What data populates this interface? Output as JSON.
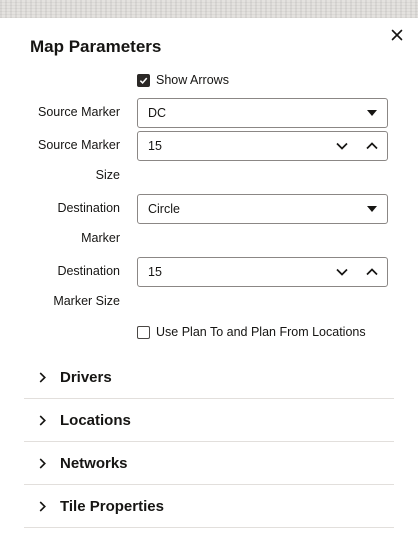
{
  "dialog": {
    "title": "Map Parameters",
    "close_icon": "close-icon"
  },
  "show_arrows": {
    "label": "Show Arrows",
    "checked": true
  },
  "source_marker": {
    "label": "Source Marker",
    "value": "DC"
  },
  "source_marker_size": {
    "label_line1": "Source Marker",
    "label_line2": "Size",
    "value": "15"
  },
  "destination_marker": {
    "label_line1": "Destination",
    "label_line2": "Marker",
    "value": "Circle"
  },
  "destination_marker_size": {
    "label_line1": "Destination",
    "label_line2": "Marker Size",
    "value": "15"
  },
  "use_plan_locations": {
    "label": "Use Plan To and Plan From Locations",
    "checked": false
  },
  "sections": [
    {
      "label": "Drivers"
    },
    {
      "label": "Locations"
    },
    {
      "label": "Networks"
    },
    {
      "label": "Tile Properties"
    }
  ],
  "colors": {
    "text": "#161513",
    "border": "#8b8785",
    "divider": "#e2dfdc"
  }
}
